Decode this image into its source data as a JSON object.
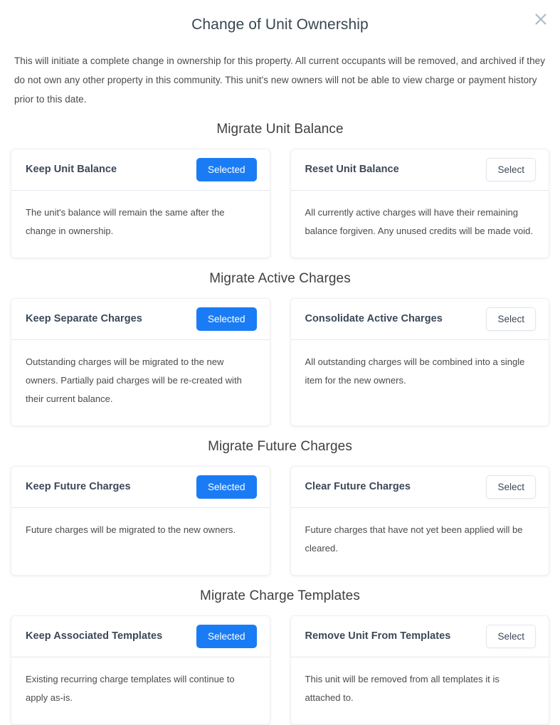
{
  "dialog": {
    "title": "Change of Unit Ownership",
    "close_icon": "close-icon",
    "intro": "This will initiate a complete change in ownership for this property. All current occupants will be removed, and archived if they do not own any other property in this community. This unit's new owners will not be able to view charge or payment history prior to this date."
  },
  "labels": {
    "selected": "Selected",
    "select": "Select"
  },
  "colors": {
    "accent_blue": "#1a7cf5",
    "title_slate": "#37474f",
    "card_title_slate": "#3c4858",
    "body_text": "#4a4a4a",
    "divider": "#e3e8ef",
    "card_border": "#f0f0f2",
    "close_icon": "#aab7c4"
  },
  "sections": [
    {
      "heading": "Migrate Unit Balance",
      "options": [
        {
          "title": "Keep Unit Balance",
          "button": "Selected",
          "state": "selected",
          "description": "The unit's balance will remain the same after the change in ownership."
        },
        {
          "title": "Reset Unit Balance",
          "button": "Select",
          "state": "unselected",
          "description": "All currently active charges will have their remaining balance forgiven. Any unused credits will be made void."
        }
      ]
    },
    {
      "heading": "Migrate Active Charges",
      "options": [
        {
          "title": "Keep Separate Charges",
          "button": "Selected",
          "state": "selected",
          "description": "Outstanding charges will be migrated to the new owners. Partially paid charges will be re-created with their current balance."
        },
        {
          "title": "Consolidate Active Charges",
          "button": "Select",
          "state": "unselected",
          "description": "All outstanding charges will be combined into a single item for the new owners."
        }
      ]
    },
    {
      "heading": "Migrate Future Charges",
      "options": [
        {
          "title": "Keep Future Charges",
          "button": "Selected",
          "state": "selected",
          "description": "Future charges will be migrated to the new owners."
        },
        {
          "title": "Clear Future Charges",
          "button": "Select",
          "state": "unselected",
          "description": "Future charges that have not yet been applied will be cleared."
        }
      ]
    },
    {
      "heading": "Migrate Charge Templates",
      "options": [
        {
          "title": "Keep Associated Templates",
          "button": "Selected",
          "state": "selected",
          "description": "Existing recurring charge templates will continue to apply as-is."
        },
        {
          "title": "Remove Unit From Templates",
          "button": "Select",
          "state": "unselected",
          "description": "This unit will be removed from all templates it is attached to."
        }
      ]
    }
  ]
}
